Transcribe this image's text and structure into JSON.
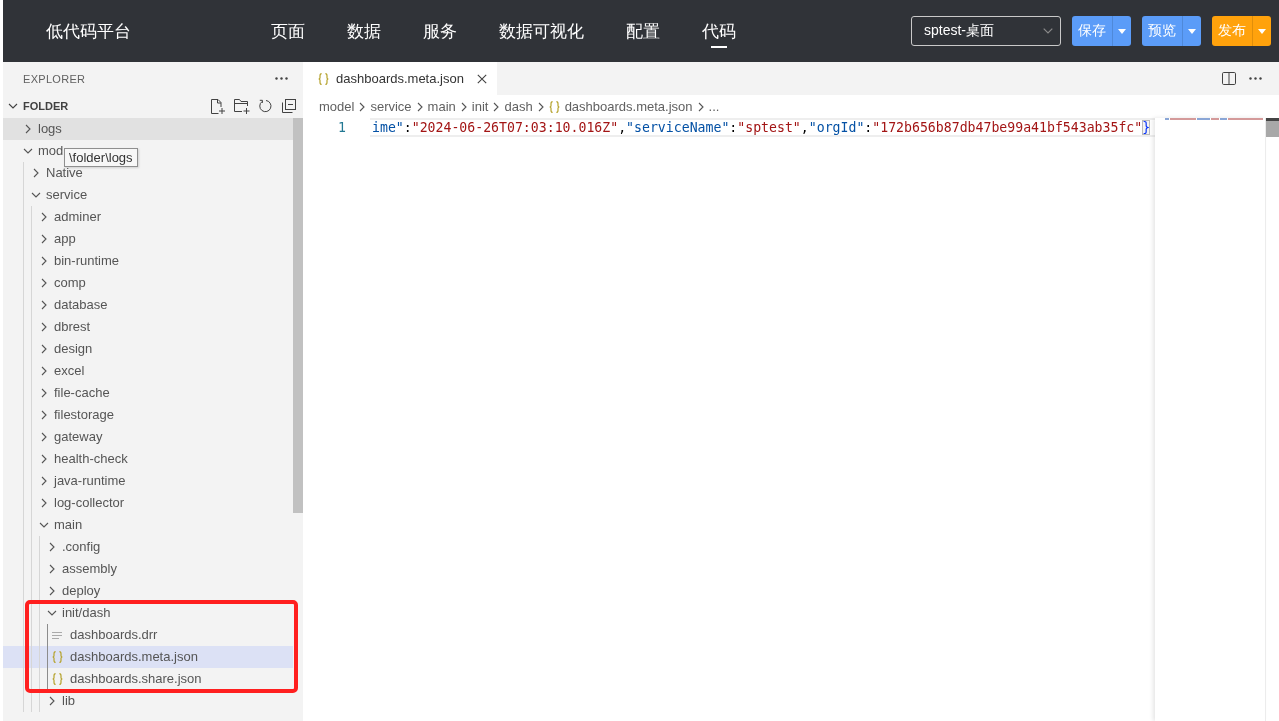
{
  "top_bar": {
    "logo": "低代码平台",
    "nav": [
      {
        "label": "页面",
        "selected": false
      },
      {
        "label": "数据",
        "selected": false
      },
      {
        "label": "服务",
        "selected": false
      },
      {
        "label": "数据可视化",
        "selected": false
      },
      {
        "label": "配置",
        "selected": false
      },
      {
        "label": "代码",
        "selected": true
      }
    ],
    "project_select": {
      "value": "sptest-桌面"
    },
    "actions": [
      {
        "label": "保存",
        "color": "#5b9cf8"
      },
      {
        "label": "预览",
        "color": "#5b9cf8"
      },
      {
        "label": "发布",
        "color": "#ffa20c"
      }
    ]
  },
  "sidebar": {
    "title": "EXPLORER",
    "section": {
      "title": "FOLDER",
      "expanded": true
    },
    "tooltip": {
      "text": "\\folder\\logs"
    },
    "tree": [
      {
        "name": "logs",
        "kind": "folder",
        "expanded": false,
        "hovered": true,
        "selected": false,
        "boxed": false
      },
      {
        "name": "mod",
        "kind": "folder",
        "expanded": true,
        "hovered": false,
        "selected": false,
        "boxed": false,
        "children": [
          {
            "name": "Native",
            "kind": "folder",
            "expanded": false,
            "hovered": false,
            "selected": false,
            "boxed": false
          },
          {
            "name": "service",
            "kind": "folder",
            "expanded": true,
            "hovered": false,
            "selected": false,
            "boxed": false,
            "children": [
              {
                "name": "adminer",
                "kind": "folder",
                "expanded": false,
                "hovered": false,
                "selected": false,
                "boxed": false
              },
              {
                "name": "app",
                "kind": "folder",
                "expanded": false,
                "hovered": false,
                "selected": false,
                "boxed": false
              },
              {
                "name": "bin-runtime",
                "kind": "folder",
                "expanded": false,
                "hovered": false,
                "selected": false,
                "boxed": false
              },
              {
                "name": "comp",
                "kind": "folder",
                "expanded": false,
                "hovered": false,
                "selected": false,
                "boxed": false
              },
              {
                "name": "database",
                "kind": "folder",
                "expanded": false,
                "hovered": false,
                "selected": false,
                "boxed": false
              },
              {
                "name": "dbrest",
                "kind": "folder",
                "expanded": false,
                "hovered": false,
                "selected": false,
                "boxed": false
              },
              {
                "name": "design",
                "kind": "folder",
                "expanded": false,
                "hovered": false,
                "selected": false,
                "boxed": false
              },
              {
                "name": "excel",
                "kind": "folder",
                "expanded": false,
                "hovered": false,
                "selected": false,
                "boxed": false
              },
              {
                "name": "file-cache",
                "kind": "folder",
                "expanded": false,
                "hovered": false,
                "selected": false,
                "boxed": false
              },
              {
                "name": "filestorage",
                "kind": "folder",
                "expanded": false,
                "hovered": false,
                "selected": false,
                "boxed": false
              },
              {
                "name": "gateway",
                "kind": "folder",
                "expanded": false,
                "hovered": false,
                "selected": false,
                "boxed": false
              },
              {
                "name": "health-check",
                "kind": "folder",
                "expanded": false,
                "hovered": false,
                "selected": false,
                "boxed": false
              },
              {
                "name": "java-runtime",
                "kind": "folder",
                "expanded": false,
                "hovered": false,
                "selected": false,
                "boxed": false
              },
              {
                "name": "log-collector",
                "kind": "folder",
                "expanded": false,
                "hovered": false,
                "selected": false,
                "boxed": false
              },
              {
                "name": "main",
                "kind": "folder",
                "expanded": true,
                "hovered": false,
                "selected": false,
                "boxed": false,
                "children": [
                  {
                    "name": ".config",
                    "kind": "folder",
                    "expanded": false,
                    "hovered": false,
                    "selected": false,
                    "boxed": false
                  },
                  {
                    "name": "assembly",
                    "kind": "folder",
                    "expanded": false,
                    "hovered": false,
                    "selected": false,
                    "boxed": false
                  },
                  {
                    "name": "deploy",
                    "kind": "folder",
                    "expanded": false,
                    "hovered": false,
                    "selected": false,
                    "boxed": false
                  },
                  {
                    "name": "init/dash",
                    "kind": "folder",
                    "expanded": true,
                    "hovered": false,
                    "selected": false,
                    "boxed": true,
                    "children": [
                      {
                        "name": "dashboards.drr",
                        "kind": "text-file",
                        "hovered": false,
                        "selected": false,
                        "boxed": false
                      },
                      {
                        "name": "dashboards.meta.json",
                        "kind": "json-file",
                        "hovered": false,
                        "selected": true,
                        "boxed": false
                      },
                      {
                        "name": "dashboards.share.json",
                        "kind": "json-file",
                        "hovered": false,
                        "selected": false,
                        "boxed": false
                      }
                    ]
                  },
                  {
                    "name": "lib",
                    "kind": "folder",
                    "expanded": false,
                    "hovered": false,
                    "selected": false,
                    "boxed": false
                  }
                ]
              }
            ]
          }
        ]
      }
    ]
  },
  "editor": {
    "tabs": [
      {
        "title": "dashboards.meta.json",
        "kind": "json-file",
        "selected": true
      }
    ],
    "breadcrumb": [
      {
        "text": "model",
        "kind": "folder"
      },
      {
        "text": "service",
        "kind": "folder"
      },
      {
        "text": "main",
        "kind": "folder"
      },
      {
        "text": "init",
        "kind": "folder"
      },
      {
        "text": "dash",
        "kind": "folder"
      },
      {
        "text": "dashboards.meta.json",
        "kind": "json-file"
      },
      {
        "text": "...",
        "kind": "more"
      }
    ],
    "lines": [
      {
        "number": "1",
        "current": true,
        "tokens": [
          {
            "kind": "key",
            "text": "ime\""
          },
          {
            "kind": "punct",
            "text": ":"
          },
          {
            "kind": "string",
            "text": "\"2024-06-26T07:03:10.016Z\""
          },
          {
            "kind": "punct",
            "text": ","
          },
          {
            "kind": "key",
            "text": "\"serviceName\""
          },
          {
            "kind": "punct",
            "text": ":"
          },
          {
            "kind": "string",
            "text": "\"sptest\""
          },
          {
            "kind": "punct",
            "text": ","
          },
          {
            "kind": "key",
            "text": "\"orgId\""
          },
          {
            "kind": "punct",
            "text": ":"
          },
          {
            "kind": "string",
            "text": "\"172b656b87db47be99a41bf543ab35fc\""
          },
          {
            "kind": "bracket",
            "text": "}"
          }
        ]
      }
    ]
  }
}
